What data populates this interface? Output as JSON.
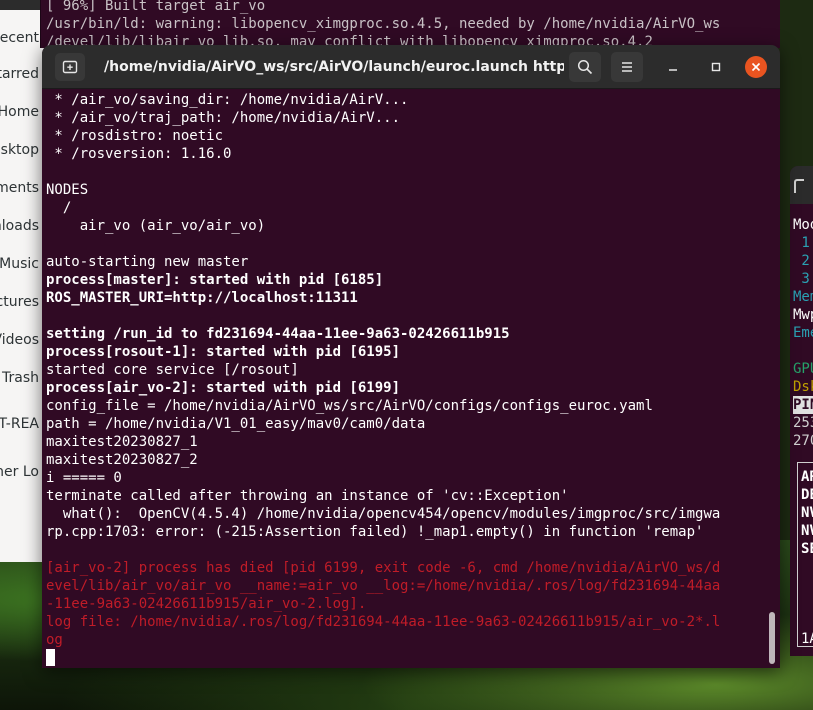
{
  "files_sidebar": {
    "items": [
      "Recent",
      "Starred",
      "Home",
      "Desktop",
      "Documents",
      "Downloads",
      "Music",
      "Pictures",
      "Videos",
      "Trash",
      "UT-REA",
      "Other Lo"
    ]
  },
  "background_terminal": {
    "lines": [
      "[ 96%] Built target air_vo",
      "/usr/bin/ld: warning: libopencv_ximgproc.so.4.5, needed by /home/nvidia/AirVO_ws",
      "/devel/lib/libair_vo_lib.so, may conflict with libopencv_ximgproc.so.4.2"
    ]
  },
  "terminal": {
    "title": "/home/nvidia/AirVO_ws/src/AirVO/launch/euroc.launch http...",
    "lines": [
      {
        "text": " * /air_vo/saving_dir: /home/nvidia/AirV...",
        "style": "normal"
      },
      {
        "text": " * /air_vo/traj_path: /home/nvidia/AirV...",
        "style": "normal"
      },
      {
        "text": " * /rosdistro: noetic",
        "style": "normal"
      },
      {
        "text": " * /rosversion: 1.16.0",
        "style": "normal"
      },
      {
        "text": "",
        "style": "normal"
      },
      {
        "text": "NODES",
        "style": "normal"
      },
      {
        "text": "  /",
        "style": "normal"
      },
      {
        "text": "    air_vo (air_vo/air_vo)",
        "style": "normal"
      },
      {
        "text": "",
        "style": "normal"
      },
      {
        "text": "auto-starting new master",
        "style": "normal"
      },
      {
        "text": "process[master]: started with pid [6185]",
        "style": "bold"
      },
      {
        "text": "ROS_MASTER_URI=http://localhost:11311",
        "style": "bold"
      },
      {
        "text": "",
        "style": "normal"
      },
      {
        "text": "setting /run_id to fd231694-44aa-11ee-9a63-02426611b915",
        "style": "bold"
      },
      {
        "text": "process[rosout-1]: started with pid [6195]",
        "style": "bold"
      },
      {
        "text": "started core service [/rosout]",
        "style": "normal"
      },
      {
        "text": "process[air_vo-2]: started with pid [6199]",
        "style": "bold"
      },
      {
        "text": "config_file = /home/nvidia/AirVO_ws/src/AirVO/configs/configs_euroc.yaml",
        "style": "normal"
      },
      {
        "text": "path = /home/nvidia/V1_01_easy/mav0/cam0/data",
        "style": "normal"
      },
      {
        "text": "maxitest20230827_1",
        "style": "normal"
      },
      {
        "text": "maxitest20230827_2",
        "style": "normal"
      },
      {
        "text": "i ===== 0",
        "style": "normal"
      },
      {
        "text": "terminate called after throwing an instance of 'cv::Exception'",
        "style": "normal"
      },
      {
        "text": "  what():  OpenCV(4.5.4) /home/nvidia/opencv454/opencv/modules/imgproc/src/imgwa",
        "style": "normal"
      },
      {
        "text": "rp.cpp:1703: error: (-215:Assertion failed) !_map1.empty() in function 'remap'",
        "style": "normal"
      },
      {
        "text": "",
        "style": "normal"
      },
      {
        "text": "[air_vo-2] process has died [pid 6199, exit code -6, cmd /home/nvidia/AirVO_ws/d",
        "style": "error"
      },
      {
        "text": "evel/lib/air_vo/air_vo __name:=air_vo __log:=/home/nvidia/.ros/log/fd231694-44aa",
        "style": "error"
      },
      {
        "text": "-11ee-9a63-02426611b915/air_vo-2.log].",
        "style": "error"
      },
      {
        "text": "log file: /home/nvidia/.ros/log/fd231694-44aa-11ee-9a63-02426611b915/air_vo-2*.l",
        "style": "error"
      },
      {
        "text": "og",
        "style": "error"
      }
    ]
  },
  "right_terminal": {
    "lines": [
      "Mod",
      " 1",
      " 2",
      " 3",
      "Mem",
      "Mwp",
      "Eme",
      "",
      "GPU",
      "Dsk",
      "PIN",
      "253",
      "270"
    ],
    "box_lines": [
      "AR",
      "DE",
      "NV",
      "NV",
      "SE"
    ],
    "bottom": "1A"
  },
  "colors": {
    "terminal_bg": "#300a24",
    "error_text": "#c01c28",
    "close_button": "#e95420"
  }
}
